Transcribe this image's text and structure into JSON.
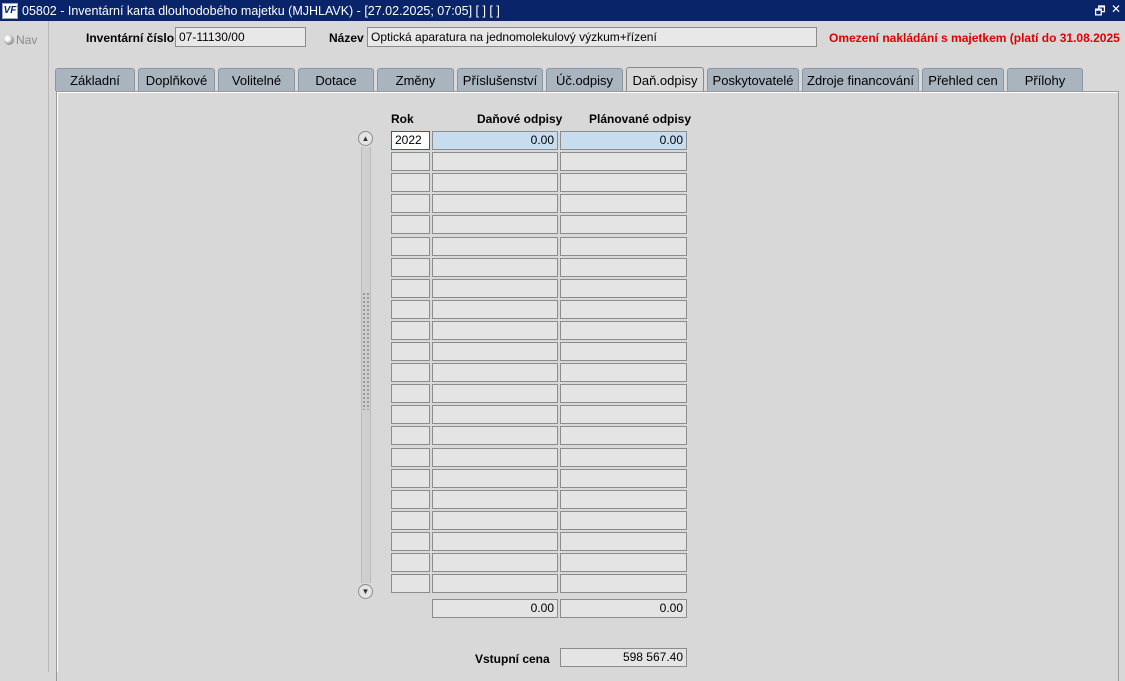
{
  "window": {
    "icon_text": "VF",
    "title": "05802 - Inventární karta dlouhodobého majetku (MJHLAVK) - [27.02.2025; 07:05]  [ ]  [ ]",
    "restore_glyph": "🗗",
    "close_glyph": "✕"
  },
  "nav": {
    "label": "Nav"
  },
  "header": {
    "inv_label": "Inventární číslo",
    "inv_value": "07-11130/00",
    "name_label": "Název",
    "name_value": "Optická aparatura na jednomolekulový výzkum+řízení",
    "warning": "Omezení nakládání s majetkem (platí do 31.08.2025"
  },
  "tabs": [
    {
      "label": "Základní"
    },
    {
      "label": "Doplňkové"
    },
    {
      "label": "Volitelné"
    },
    {
      "label": "Dotace"
    },
    {
      "label": "Změny"
    },
    {
      "label": "Příslušenství"
    },
    {
      "label": "Úč.odpisy"
    },
    {
      "label": "Daň.odpisy",
      "active": true
    },
    {
      "label": "Poskytovatelé"
    },
    {
      "label": "Zdroje financování"
    },
    {
      "label": "Přehled cen"
    },
    {
      "label": "Přílohy"
    }
  ],
  "table": {
    "col_year": "Rok",
    "col_tax": "Daňové odpisy",
    "col_planned": "Plánované odpisy",
    "rows": [
      {
        "year": "2022",
        "tax": "0.00",
        "planned": "0.00"
      },
      {
        "year": "",
        "tax": "",
        "planned": ""
      },
      {
        "year": "",
        "tax": "",
        "planned": ""
      },
      {
        "year": "",
        "tax": "",
        "planned": ""
      },
      {
        "year": "",
        "tax": "",
        "planned": ""
      },
      {
        "year": "",
        "tax": "",
        "planned": ""
      },
      {
        "year": "",
        "tax": "",
        "planned": ""
      },
      {
        "year": "",
        "tax": "",
        "planned": ""
      },
      {
        "year": "",
        "tax": "",
        "planned": ""
      },
      {
        "year": "",
        "tax": "",
        "planned": ""
      },
      {
        "year": "",
        "tax": "",
        "planned": ""
      },
      {
        "year": "",
        "tax": "",
        "planned": ""
      },
      {
        "year": "",
        "tax": "",
        "planned": ""
      },
      {
        "year": "",
        "tax": "",
        "planned": ""
      },
      {
        "year": "",
        "tax": "",
        "planned": ""
      },
      {
        "year": "",
        "tax": "",
        "planned": ""
      },
      {
        "year": "",
        "tax": "",
        "planned": ""
      },
      {
        "year": "",
        "tax": "",
        "planned": ""
      },
      {
        "year": "",
        "tax": "",
        "planned": ""
      },
      {
        "year": "",
        "tax": "",
        "planned": ""
      },
      {
        "year": "",
        "tax": "",
        "planned": ""
      },
      {
        "year": "",
        "tax": "",
        "planned": ""
      }
    ],
    "total_tax": "0.00",
    "total_planned": "0.00"
  },
  "entry_price": {
    "label": "Vstupní cena",
    "value": "598 567.40"
  }
}
